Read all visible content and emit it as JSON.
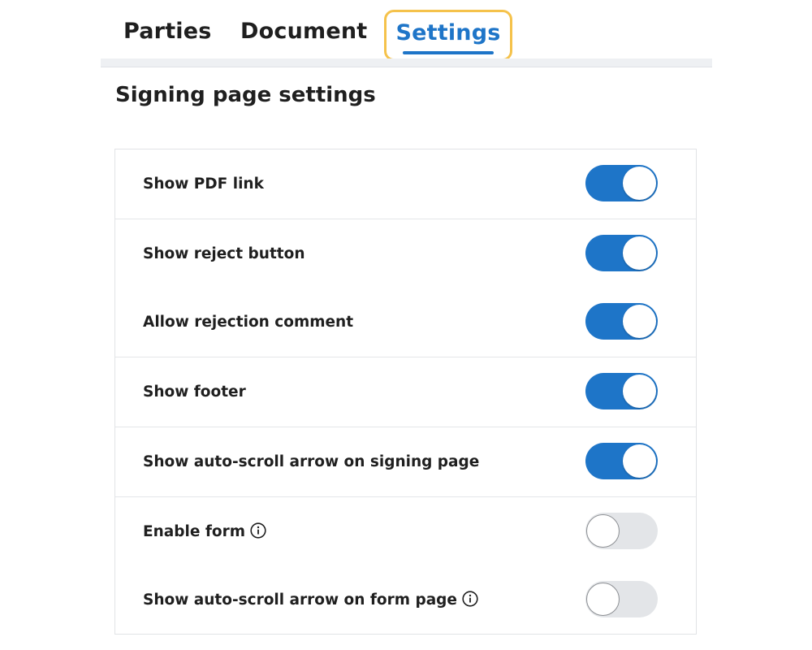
{
  "tabs": [
    {
      "label": "Parties",
      "active": false
    },
    {
      "label": "Document",
      "active": false
    },
    {
      "label": "Settings",
      "active": true
    }
  ],
  "section": {
    "title": "Signing page settings"
  },
  "settings": [
    {
      "label": "Show PDF link",
      "enabled": true,
      "info": false
    },
    {
      "label": "Show reject button",
      "enabled": true,
      "info": false
    },
    {
      "label": "Allow rejection comment",
      "enabled": true,
      "info": false
    },
    {
      "label": "Show footer",
      "enabled": true,
      "info": false
    },
    {
      "label": "Show auto-scroll arrow on signing page",
      "enabled": true,
      "info": false
    },
    {
      "label": "Enable form",
      "enabled": false,
      "info": true
    },
    {
      "label": "Show auto-scroll arrow on form page",
      "enabled": false,
      "info": true
    }
  ],
  "colors": {
    "accent": "#1e75c8",
    "highlight": "#f5c24b",
    "toggle_off": "#e3e5e8"
  }
}
